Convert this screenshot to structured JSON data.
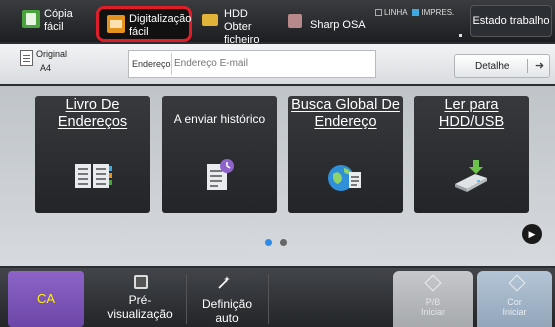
{
  "topbar": {
    "modes": [
      {
        "label": "Cópia\nfácil",
        "icon": "copy-icon"
      },
      {
        "label": "Digitalização\nfácil",
        "icon": "scan-icon",
        "selected": true,
        "highlight_color": "#e01e2a"
      },
      {
        "label": "HDD\nObter ficheiro",
        "icon": "hdd-folder-icon"
      },
      {
        "label": "Sharp OSA",
        "icon": "sharp-osa-icon"
      }
    ],
    "status_line": "LINHA",
    "status_print": "IMPRES.",
    "job_status_button": "Estado trabalho"
  },
  "address_row": {
    "original_label": "Original",
    "original_value": "A4",
    "address_label": "Endereço",
    "address_placeholder": "Endereço E-mail",
    "detail_button": "Detalhe"
  },
  "tiles": [
    {
      "label": "Livro De Endereços",
      "icon": "address-book-icon"
    },
    {
      "label": "A enviar histórico",
      "icon": "send-history-icon"
    },
    {
      "label": "Busca Global De Endereço",
      "icon": "global-address-search-icon"
    },
    {
      "label": "Ler para HDD/USB",
      "icon": "hdd-usb-icon"
    }
  ],
  "pager": {
    "pages": 2,
    "current": 1
  },
  "bottombar": {
    "ca_label": "CA",
    "preview_label": "Pré-\nvisualização",
    "auto_label": "Definição\nauto",
    "bw_label": "P/B\nIniciar",
    "color_label": "Cor\nIniciar",
    "ca_color": "#7d55b8",
    "color_start_color": "#a3b6c9"
  }
}
